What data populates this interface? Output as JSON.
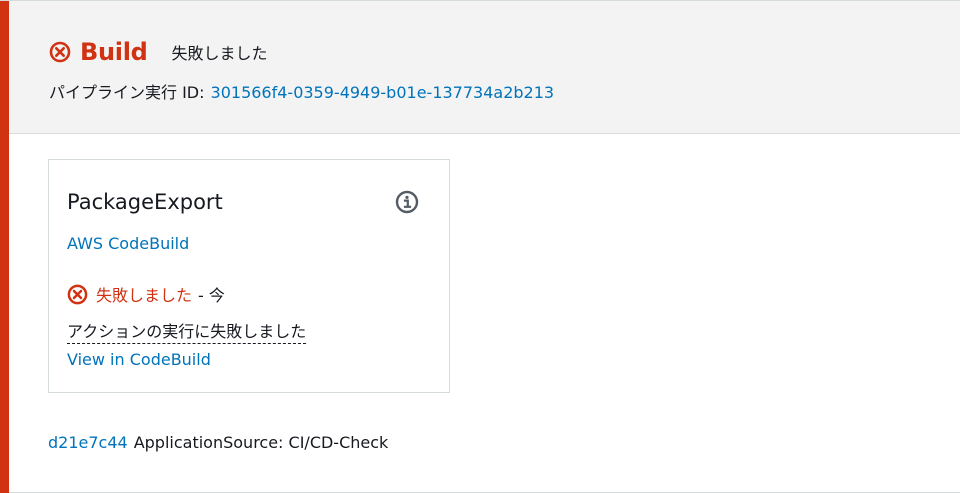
{
  "stage": {
    "name": "Build",
    "status": "失敗しました",
    "execution_label": "パイプライン実行 ID:",
    "execution_id": "301566f4-0359-4949-b01e-137734a2b213"
  },
  "action": {
    "name": "PackageExport",
    "provider": "AWS CodeBuild",
    "status": "失敗しました",
    "time": "- 今",
    "error_message": "アクションの実行に失敗しました",
    "view_link": "View in CodeBuild"
  },
  "source": {
    "commit_id": "d21e7c44",
    "text": "ApplicationSource: CI/CD-Check"
  },
  "icons": {
    "stage_status": "error-circle-icon",
    "action_status": "error-circle-icon",
    "info": "info-icon"
  },
  "colors": {
    "error": "#d13212",
    "link": "#0073bb",
    "header_bg": "#f3f3f3",
    "text": "#16191f"
  }
}
